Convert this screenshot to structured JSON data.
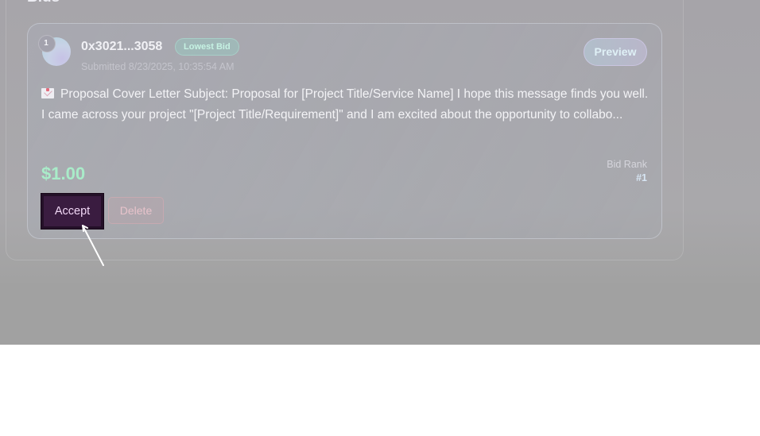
{
  "section": {
    "heading": "Bids"
  },
  "bid": {
    "rank_number": "1",
    "address": "0x3021...3058",
    "badge": "Lowest Bid",
    "submitted": "Submitted 8/23/2025, 10:35:54 AM",
    "preview_label": "Preview",
    "proposal_text": "Proposal Cover Letter Subject: Proposal for [Project Title/Service Name] I hope this message finds you well. I came across your project \"[Project Title/Requirement]\" and I am excited about the opportunity to collabo...",
    "proposal_icon": "envelope-icon",
    "price": "$1.00",
    "rank_label": "Bid Rank",
    "rank_value": "#1",
    "accept_label": "Accept",
    "delete_label": "Delete"
  },
  "colors": {
    "backdrop": "#a6a4a9",
    "price": "#a9ecc9",
    "accept_bg": "#3a1c40",
    "badge_text": "#c6f2e3"
  }
}
